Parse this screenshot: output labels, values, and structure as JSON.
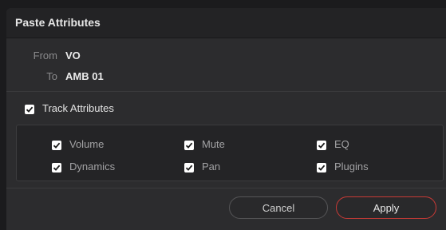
{
  "dialog": {
    "title": "Paste Attributes",
    "from_label": "From",
    "from_value": "VO",
    "to_label": "To",
    "to_value": "AMB 01"
  },
  "track_attributes": {
    "label": "Track Attributes",
    "checked": true
  },
  "attributes": [
    {
      "label": "Volume",
      "checked": true
    },
    {
      "label": "Mute",
      "checked": true
    },
    {
      "label": "EQ",
      "checked": true
    },
    {
      "label": "Dynamics",
      "checked": true
    },
    {
      "label": "Pan",
      "checked": true
    },
    {
      "label": "Plugins",
      "checked": true
    }
  ],
  "buttons": {
    "cancel": "Cancel",
    "apply": "Apply"
  },
  "colors": {
    "accent_apply_border": "#c83a36"
  }
}
